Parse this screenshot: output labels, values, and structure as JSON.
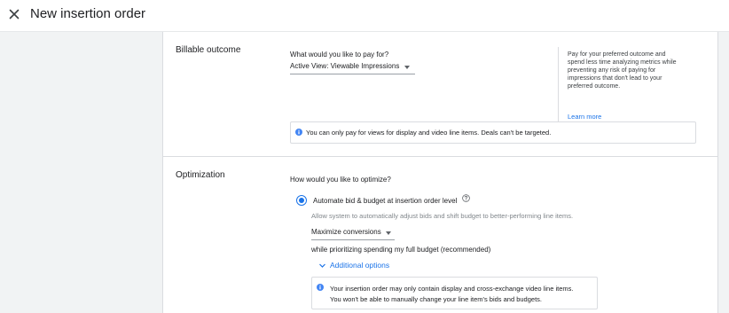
{
  "header": {
    "title": "New insertion order"
  },
  "billable": {
    "section_title": "Billable outcome",
    "question": "What would you like to pay for?",
    "selected": "Active View: Viewable Impressions",
    "side_text": "Pay for your preferred outcome and spend less time analyzing metrics while preventing any risk of paying for impressions that don't lead to your preferred outcome.",
    "learn_more": "Learn more",
    "info": "You can only pay for views for display and video line items. Deals can't be targeted."
  },
  "optimization": {
    "section_title": "Optimization",
    "question": "How would you like to optimize?",
    "option_label": "Automate bid & budget at insertion order level",
    "option_hint": "Allow system to automatically adjust bids and shift budget to better-performing line items.",
    "goal_selected": "Maximize conversions",
    "priority_text": "while prioritizing spending my full budget (recommended)",
    "additional_options": "Additional options",
    "info_line1": "Your insertion order may only contain display and cross-exchange video line items.",
    "info_line2": "You won't be able to manually change your line item's bids and budgets."
  },
  "colors": {
    "accent": "#1a73e8",
    "info_icon": "#4285f4",
    "divider": "#dadce0"
  }
}
